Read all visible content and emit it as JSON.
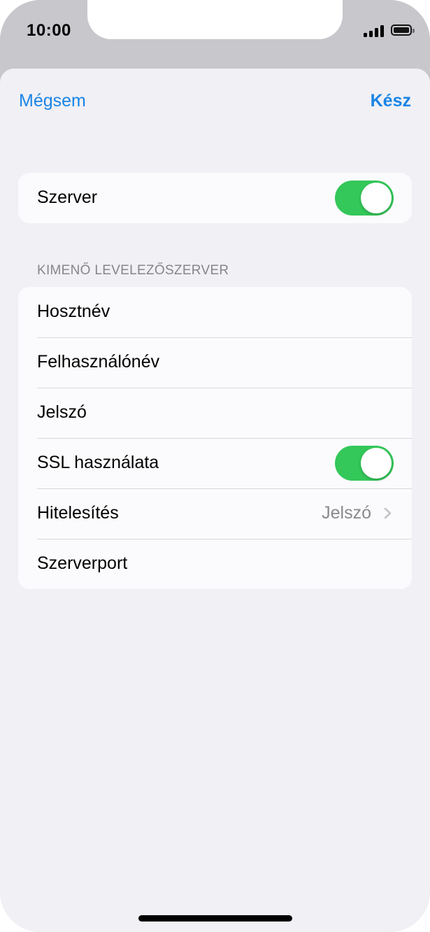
{
  "status_bar": {
    "time": "10:00",
    "signal_icon": "cellular-signal-icon",
    "battery_icon": "battery-icon"
  },
  "nav": {
    "cancel_label": "Mégsem",
    "done_label": "Kész"
  },
  "server_group": {
    "label": "Szerver",
    "toggle_on": true
  },
  "outgoing_section": {
    "header": "KIMENŐ LEVELEZŐSZERVER",
    "rows": [
      {
        "label": "Hosztnév"
      },
      {
        "label": "Felhasználónév"
      },
      {
        "label": "Jelszó"
      },
      {
        "label": "SSL használata",
        "toggle_on": true
      },
      {
        "label": "Hitelesítés",
        "detail": "Jelszó",
        "chevron_icon": "chevron-right-icon"
      },
      {
        "label": "Szerverport"
      }
    ]
  },
  "colors": {
    "accent": "#1a84e5",
    "toggle_on": "#34c759",
    "background": "#f0f0f5",
    "status_bar": "#c7c7cc"
  }
}
